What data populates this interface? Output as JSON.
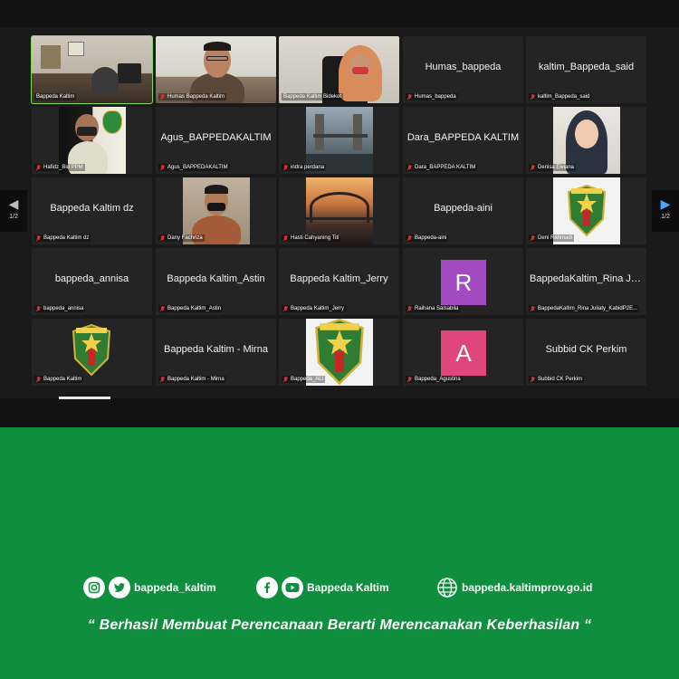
{
  "meeting": {
    "page_label_left": "1/2",
    "page_label_right": "1/2"
  },
  "participants": [
    {
      "name": "Bappeda Kaltim",
      "type": "video",
      "active": true
    },
    {
      "name": "Humas Bappeda Kaltim",
      "type": "video"
    },
    {
      "name": "Bappeda Kaltim Bidekot",
      "type": "video"
    },
    {
      "name": "Humas_bappeda",
      "type": "name",
      "display": "Humas_bappeda"
    },
    {
      "name": "kaltim_Bappeda_said",
      "type": "name",
      "display": "kaltim_Bappeda_said"
    },
    {
      "name": "Hafidz_Bid PPM",
      "type": "video"
    },
    {
      "name": "Agus_BAPPEDAKALTIM",
      "type": "name",
      "display": "Agus_BAPPEDAKALTIM"
    },
    {
      "name": "indra perdana",
      "type": "video"
    },
    {
      "name": "Dara_BAPPEDA KALTIM",
      "type": "name",
      "display": "Dara_BAPPEDA KALTIM"
    },
    {
      "name": "Denisa Elviana",
      "type": "video"
    },
    {
      "name": "Bappeda Kaltim dz",
      "type": "name",
      "display": "Bappeda Kaltim dz"
    },
    {
      "name": "Dany Fachriza",
      "type": "video"
    },
    {
      "name": "Hasti Cahyaning Titi",
      "type": "video"
    },
    {
      "name": "Bappeda-aini",
      "type": "name",
      "display": "Bappeda-aini"
    },
    {
      "name": "Deni Rahmadi",
      "type": "emblem"
    },
    {
      "name": "bappeda_annisa",
      "type": "name",
      "display": "bappeda_annisa"
    },
    {
      "name": "Bappeda Kaltim_Astin",
      "type": "name",
      "display": "Bappeda Kaltim_Astin"
    },
    {
      "name": "Bappeda Kaltim_Jerry",
      "type": "name",
      "display": "Bappeda Kaltim_Jerry"
    },
    {
      "name": "Raihana Salsabila",
      "type": "avatar",
      "initial": "R",
      "color": "#a34bc0"
    },
    {
      "name": "BappedaKaltim_Rina Juliaty_KabidP2E...",
      "type": "name",
      "display": "BappedaKaltim_Rina Jul..."
    },
    {
      "name": "Bappeda Kaltim",
      "type": "emblem"
    },
    {
      "name": "Bappeda Kaltim - Mirna",
      "type": "name",
      "display": "Bappeda Kaltim - Mirna"
    },
    {
      "name": "Bappeda_ALI",
      "type": "emblem"
    },
    {
      "name": "Bappeda_Agustina",
      "type": "avatar",
      "initial": "A",
      "color": "#e0457b"
    },
    {
      "name": "Subbid CK Perkim",
      "type": "name",
      "display": "Subbid CK Perkim"
    }
  ],
  "footer": {
    "social1_handle": "bappeda_kaltim",
    "social2_handle": "Bappeda Kaltim",
    "website": "bappeda.kaltimprov.go.id",
    "tagline": "“ Berhasil  Membuat Perencanaan Berarti Merencanakan Keberhasilan “"
  },
  "colors": {
    "footer_bg": "#0f8e3d",
    "zoom_bg": "#1a1a1a",
    "tile_bg": "#242424",
    "active_speaker": "#7ed957",
    "muted_mic": "#d32f2f"
  },
  "icons": [
    "instagram-icon",
    "twitter-icon",
    "facebook-icon",
    "youtube-icon",
    "globe-icon",
    "microphone-muted-icon",
    "chevron-left-icon",
    "chevron-right-icon"
  ]
}
